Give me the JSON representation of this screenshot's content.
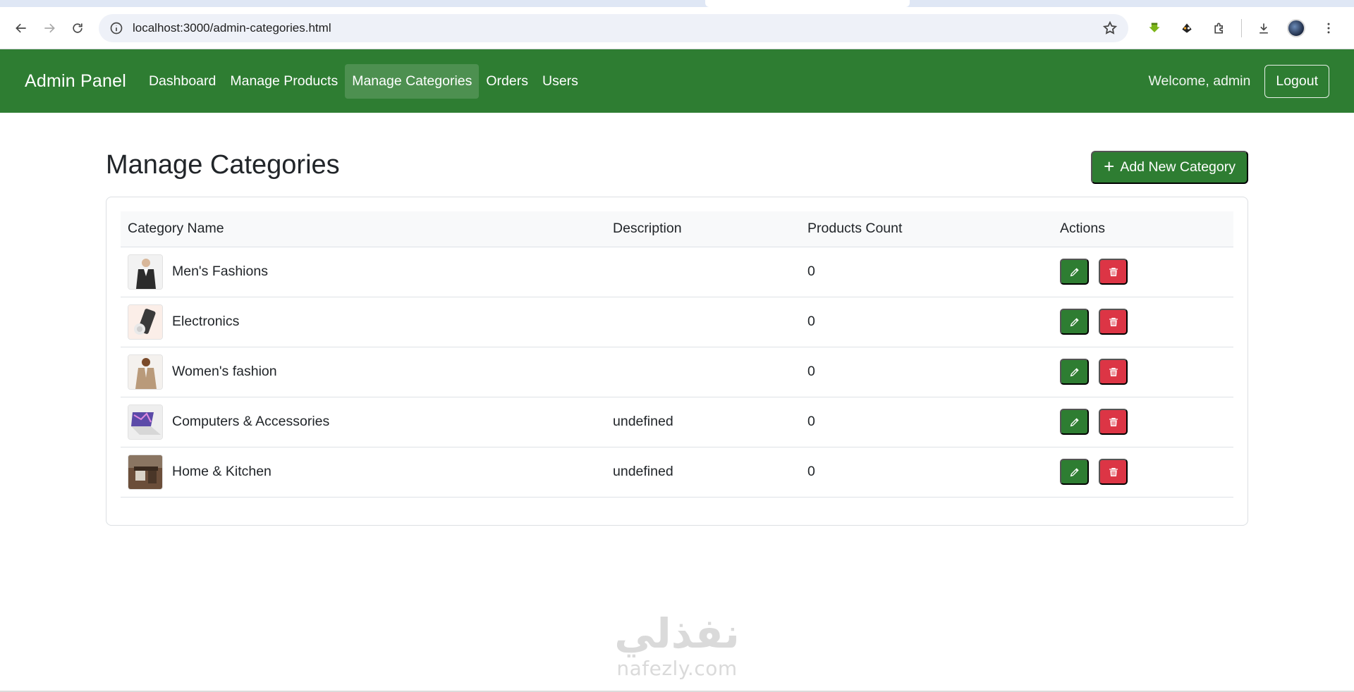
{
  "browser": {
    "url": "localhost:3000/admin-categories.html"
  },
  "navbar": {
    "brand": "Admin Panel",
    "links": [
      {
        "label": "Dashboard",
        "active": false
      },
      {
        "label": "Manage Products",
        "active": false
      },
      {
        "label": "Manage Categories",
        "active": true
      },
      {
        "label": "Orders",
        "active": false
      },
      {
        "label": "Users",
        "active": false
      }
    ],
    "welcome": "Welcome, admin",
    "logout_label": "Logout"
  },
  "page": {
    "title": "Manage Categories",
    "add_button_label": "Add New Category",
    "add_button_icon": "plus-icon"
  },
  "table": {
    "headers": [
      "Category Name",
      "Description",
      "Products Count",
      "Actions"
    ],
    "rows": [
      {
        "name": "Men's Fashions",
        "description": "",
        "count": "0",
        "thumb": "mens-fashion-thumbnail"
      },
      {
        "name": "Electronics",
        "description": "",
        "count": "0",
        "thumb": "electronics-thumbnail"
      },
      {
        "name": "Women's fashion",
        "description": "",
        "count": "0",
        "thumb": "womens-fashion-thumbnail"
      },
      {
        "name": "Computers & Accessories",
        "description": "undefined",
        "count": "0",
        "thumb": "computers-thumbnail"
      },
      {
        "name": "Home & Kitchen",
        "description": "undefined",
        "count": "0",
        "thumb": "home-kitchen-thumbnail"
      }
    ],
    "edit_icon": "pencil-icon",
    "delete_icon": "trash-icon"
  },
  "watermark": {
    "arabic": "نفذلي",
    "latin": "nafezly.com"
  },
  "colors": {
    "primary_green": "#2e7d32",
    "danger_red": "#dc3545",
    "header_bg": "#f8f9fa"
  }
}
